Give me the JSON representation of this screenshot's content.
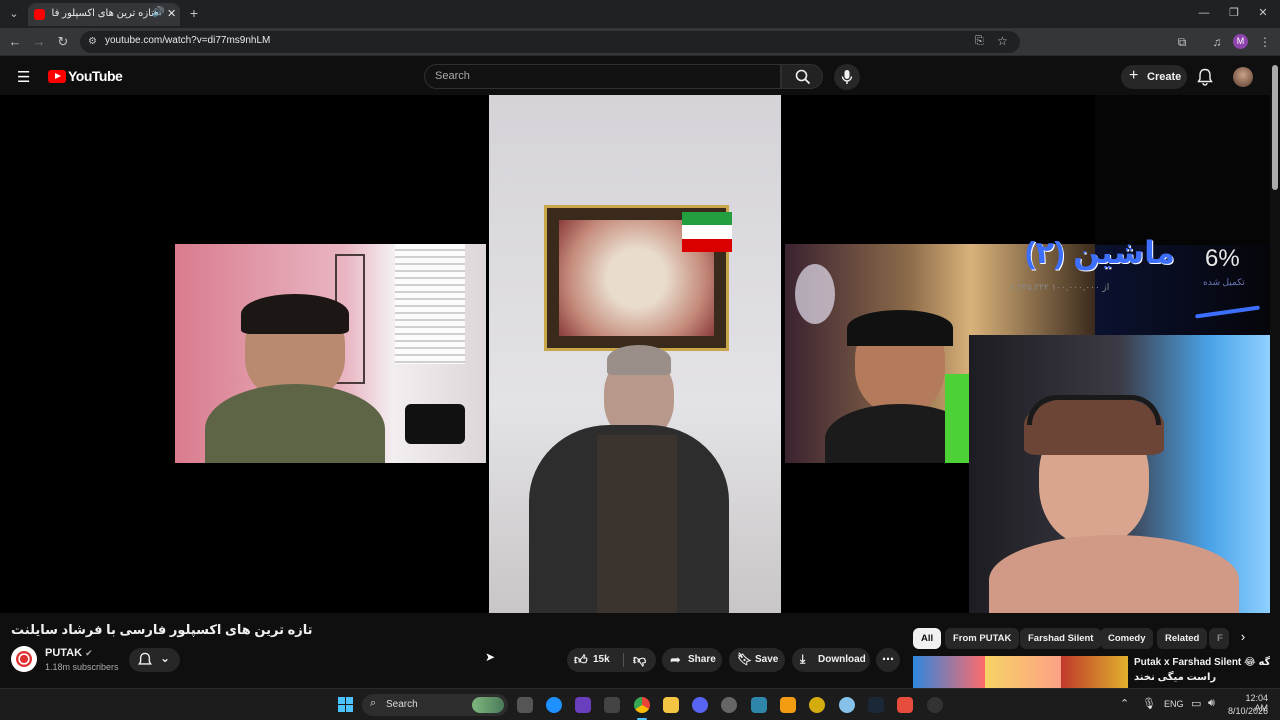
{
  "browser": {
    "tab_title": "تازه ترین های اکسپلور فارسی",
    "url": "youtube.com/watch?v=di77ms9nhLM",
    "profile_initial": "M"
  },
  "youtube": {
    "logo_text": "YouTube",
    "search_placeholder": "Search",
    "create_label": "Create"
  },
  "video": {
    "overlay_title": "ماشین (۲)",
    "overlay_amount": "۶,۲۴۵,۲۲۲ از ۱۰۰,۰۰۰,۰۰۰",
    "overlay_percent": "6%",
    "overlay_caption": "تکمیل شده",
    "progress": 0.06
  },
  "watch": {
    "title": "تازه ترین های اکسپلور فارسی با فرشاد سایلنت",
    "channel_name": "PUTAK",
    "subscribers": "1.18m subscribers",
    "likes": "15k",
    "share_label": "Share",
    "save_label": "Save",
    "download_label": "Download"
  },
  "chips": [
    "All",
    "From PUTAK",
    "Farshad Silent",
    "Comedy",
    "Related",
    "F"
  ],
  "recommended": {
    "title": "Putak x Farshad Silent 😂 اگه",
    "subtitle": "راست میگی نخند"
  },
  "taskbar": {
    "search_label": "Search",
    "lang": "ENG",
    "time": "12:04 AM",
    "date": "8/10/2026"
  },
  "colors": {
    "yt_red": "#ff0000",
    "bg": "#0f0f0f",
    "accent_blue": "#3d6fff"
  }
}
